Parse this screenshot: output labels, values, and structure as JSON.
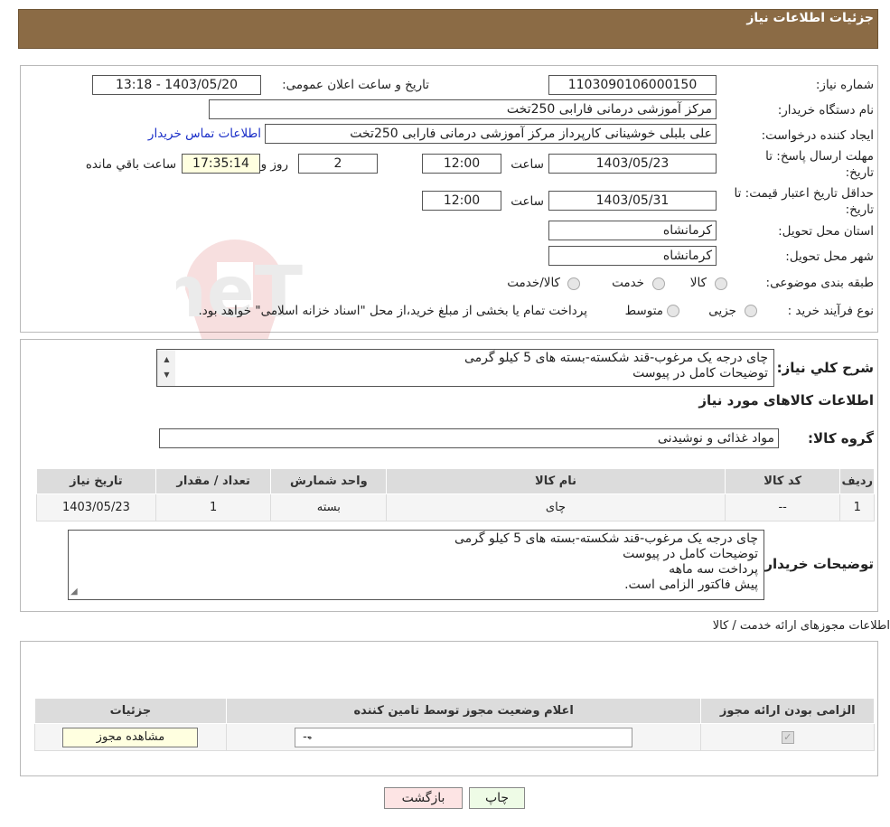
{
  "header": {
    "title": "جزئیات اطلاعات نیاز"
  },
  "watermark": {
    "text": "AriaTender.neT"
  },
  "form": {
    "need_number_label": "شماره نیاز:",
    "need_number": "1103090106000150",
    "announce_label": "تاریخ و ساعت اعلان عمومی:",
    "announce_value": "1403/05/20 - 13:18",
    "buyer_org_label": "نام دستگاه خریدار:",
    "buyer_org": "مرکز آموزشی  درمانی فارابی 250تخت",
    "creator_label": "ایجاد کننده درخواست:",
    "creator": "علی بلبلی خوشینانی کارپرداز مرکز آموزشی  درمانی فارابی 250تخت",
    "contact_link": "اطلاعات تماس خریدار",
    "deadline_label_1": "مهلت ارسال پاسخ: تا",
    "deadline_label_2": "تاریخ:",
    "deadline_date": "1403/05/23",
    "time_label": "ساعت",
    "deadline_time": "12:00",
    "days_value": "2",
    "days_label": "روز و",
    "remaining_time": "17:35:14",
    "remaining_label": "ساعت باقي مانده",
    "validity_label_1": "حداقل تاریخ اعتبار قیمت: تا",
    "validity_label_2": "تاریخ:",
    "validity_date": "1403/05/31",
    "validity_time": "12:00",
    "province_label": "استان محل تحویل:",
    "province": "کرمانشاه",
    "city_label": "شهر محل تحویل:",
    "city": "کرمانشاه",
    "category_label": "طبقه بندی موضوعی:",
    "category_options": [
      "کالا",
      "خدمت",
      "کالا/خدمت"
    ],
    "process_label": "نوع فرآیند خرید :",
    "process_options": [
      "جزیی",
      "متوسط"
    ],
    "process_note": "پرداخت تمام یا بخشی از مبلغ خرید،از محل \"اسناد خزانه اسلامی\" خواهد بود."
  },
  "summary": {
    "label": "شرح کلي نياز:",
    "lines": [
      "چای درجه یک مرغوب-قند شکسته-بسته های 5 کیلو گرمی",
      "توضیحات کامل در پیوست"
    ],
    "goods_title": "اطلاعات کالاهای مورد نیاز",
    "group_label": "گروه کالا:",
    "group_value": "مواد غذائی و نوشیدنی",
    "table": {
      "headers": [
        "ردیف",
        "کد کالا",
        "نام کالا",
        "واحد شمارش",
        "تعداد / مقدار",
        "تاریخ نیاز"
      ],
      "rows": [
        [
          "1",
          "--",
          "چای",
          "بسته",
          "1",
          "1403/05/23"
        ]
      ]
    },
    "buyer_notes_label": "توضیحات خریدار:",
    "buyer_notes": [
      "چای درجه یک مرغوب-قند شکسته-بسته های 5 کیلو گرمی",
      "توضیحات کامل در پیوست",
      "پرداخت سه ماهه",
      "پیش فاکتور الزامی است."
    ]
  },
  "permits": {
    "title": "اطلاعات مجوزهای ارائه خدمت / کالا",
    "headers": [
      "الزامی بودن ارائه مجوز",
      "اعلام وضعیت مجوز توسط تامین کننده",
      "جزئیات"
    ],
    "select_value": "--",
    "view_button": "مشاهده مجوز"
  },
  "buttons": {
    "print": "چاپ",
    "back": "بازگشت"
  },
  "colors": {
    "header": "#8b6b45",
    "accent_link": "#1b2fc8",
    "yellow_field": "#ffffe0",
    "back_button": "#fde4e4",
    "print_button": "#eefbe6"
  }
}
